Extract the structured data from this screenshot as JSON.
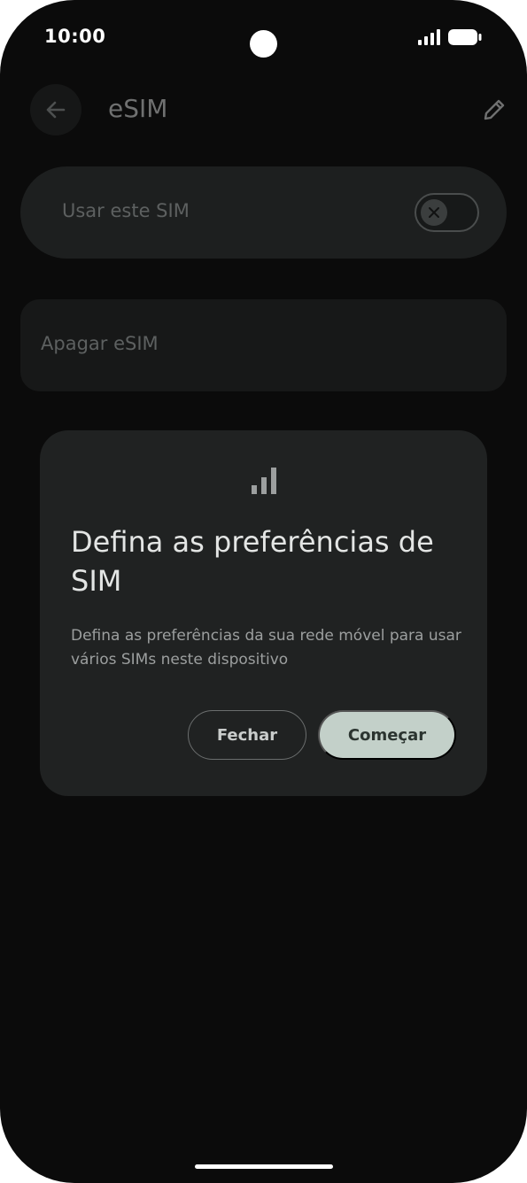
{
  "status_bar": {
    "time": "10:00"
  },
  "app_bar": {
    "title": "eSIM",
    "back_icon": "arrow-left-icon",
    "edit_icon": "pencil-icon"
  },
  "use_sim": {
    "label": "Usar este SIM",
    "toggle_on": false
  },
  "erase": {
    "label": "Apagar eSIM"
  },
  "dialog": {
    "icon": "signal-bars-icon",
    "title": "Defina as preferências de SIM",
    "body": "Defina as preferências da sua rede móvel para usar vários SIMs neste dispositivo",
    "close_label": "Fechar",
    "start_label": "Começar"
  },
  "colors": {
    "background": "#0b0b0b",
    "dialog_surface": "#202222",
    "primary_button": "#c3d0c9",
    "title_text": "#e3e5e4"
  }
}
